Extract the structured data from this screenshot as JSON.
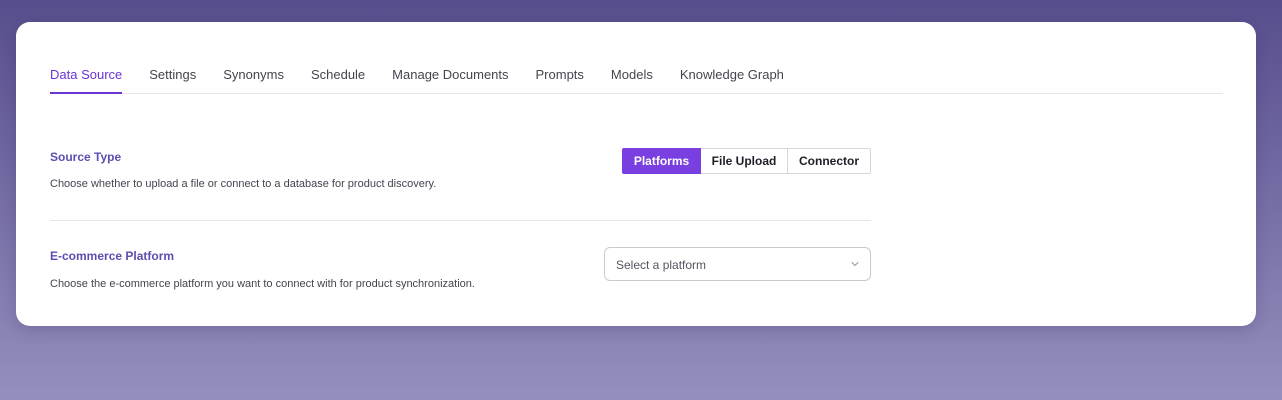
{
  "tabs": [
    {
      "label": "Data Source",
      "active": true
    },
    {
      "label": "Settings",
      "active": false
    },
    {
      "label": "Synonyms",
      "active": false
    },
    {
      "label": "Schedule",
      "active": false
    },
    {
      "label": "Manage Documents",
      "active": false
    },
    {
      "label": "Prompts",
      "active": false
    },
    {
      "label": "Models",
      "active": false
    },
    {
      "label": "Knowledge Graph",
      "active": false
    }
  ],
  "source_type": {
    "title": "Source Type",
    "description": "Choose whether to upload a file or connect to a database for product discovery.",
    "options": [
      "Platforms",
      "File Upload",
      "Connector"
    ],
    "selected": "Platforms"
  },
  "ecommerce": {
    "title": "E-commerce Platform",
    "description": "Choose the e-commerce platform you want to connect with for product synchronization.",
    "select_placeholder": "Select a platform",
    "select_icon": "chevron-down-icon"
  },
  "colors": {
    "accent": "#7a3fe0",
    "section_title": "#5a4fb0",
    "background_top": "#574e8d",
    "background_bottom": "#948fbe"
  }
}
